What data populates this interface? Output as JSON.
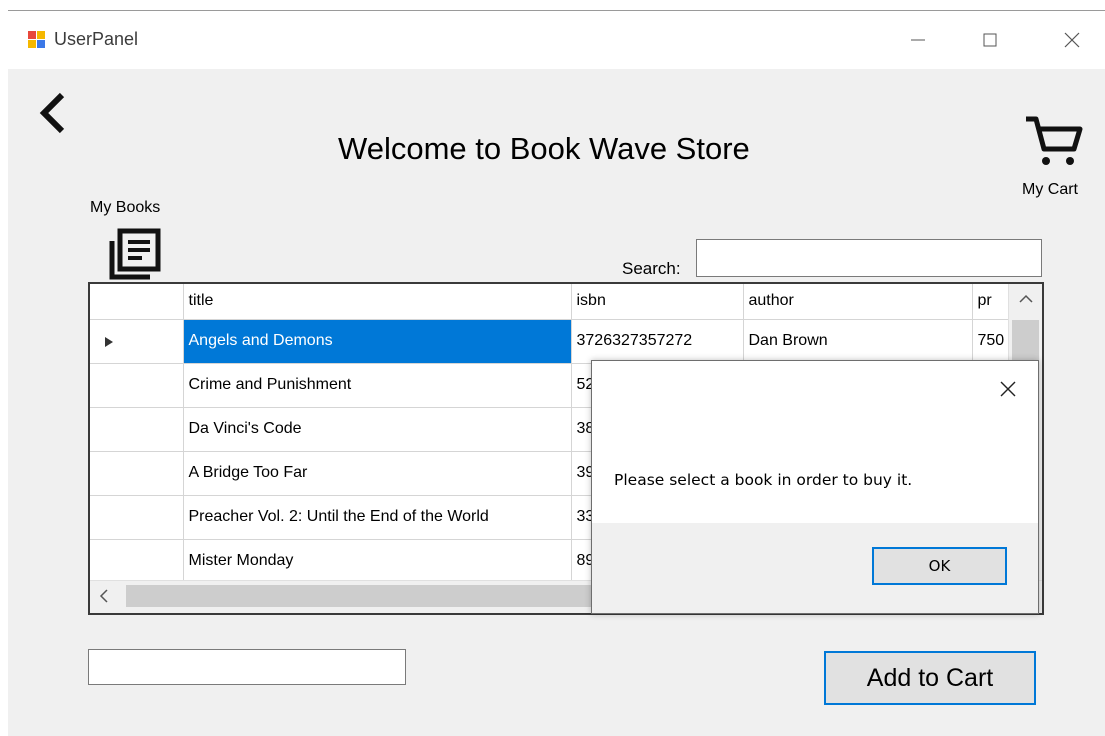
{
  "window": {
    "title": "UserPanel",
    "minimize_glyph": "—",
    "maximize_glyph": "☐",
    "close_glyph": "✕"
  },
  "header": {
    "title": "Welcome to Book Wave Store",
    "cart_label": "My Cart",
    "mybooks_label": "My Books",
    "search_label": "Search:",
    "search_value": ""
  },
  "grid": {
    "columns": [
      "title",
      "isbn",
      "author",
      "pr"
    ],
    "rows": [
      {
        "title": "Angels and Demons",
        "isbn": "3726327357272",
        "author": "Dan Brown",
        "price": "750"
      },
      {
        "title": "Crime and Punishment",
        "isbn": "52",
        "author": "",
        "price": ""
      },
      {
        "title": "Da Vinci's Code",
        "isbn": "38",
        "author": "",
        "price": ""
      },
      {
        "title": "A Bridge Too Far",
        "isbn": "39",
        "author": "",
        "price": ""
      },
      {
        "title": "Preacher Vol. 2: Until the End of the World",
        "isbn": "33",
        "author": "",
        "price": ""
      },
      {
        "title": "Mister Monday",
        "isbn": "89",
        "author": "",
        "price": ""
      }
    ],
    "selected_row": 0
  },
  "dialog": {
    "message": "Please select a book in order to buy it.",
    "ok_label": "OK",
    "close_glyph": "✕"
  },
  "footer": {
    "quantity_value": "",
    "add_to_cart_label": "Add to Cart"
  },
  "colors": {
    "selection": "#0078d7",
    "window_bg": "#f0f0f0",
    "button_focus_border": "#0078d7"
  }
}
